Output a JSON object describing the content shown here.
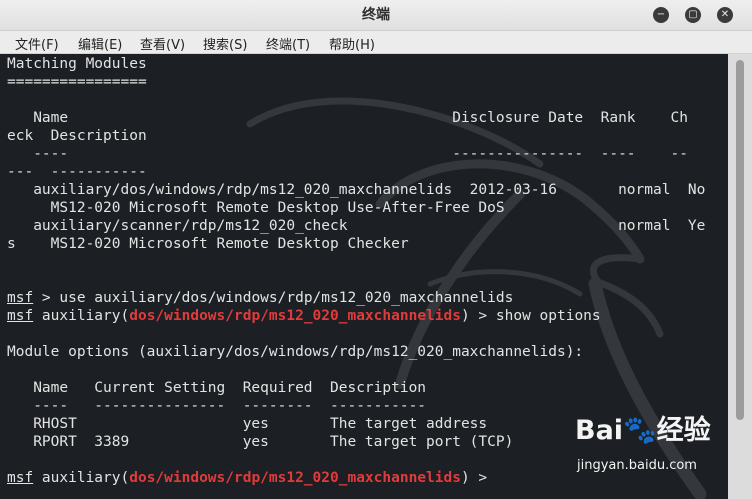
{
  "window": {
    "title": "终端",
    "minimize_glyph": "−",
    "maximize_glyph": "▢",
    "close_glyph": "✕"
  },
  "menu": [
    "文件(F)",
    "编辑(E)",
    "查看(V)",
    "搜索(S)",
    "终端(T)",
    "帮助(H)"
  ],
  "terminal": {
    "heading": "Matching Modules",
    "heading_rule": "================",
    "col_header_1": "   Name                                            Disclosure Date  Rank    Ch",
    "col_header_2": "eck  Description",
    "col_rule_1": "   ----                                            ---------------  ----    --",
    "col_rule_2": "---  -----------",
    "result1_line1": "   auxiliary/dos/windows/rdp/ms12_020_maxchannelids  2012-03-16       normal  No",
    "result1_line2": "     MS12-020 Microsoft Remote Desktop Use-After-Free DoS",
    "result2_line1": "   auxiliary/scanner/rdp/ms12_020_check                               normal  Ye",
    "result2_line2": "s    MS12-020 Microsoft Remote Desktop Checker",
    "prompt_word": "msf",
    "cmd_use": " > use auxiliary/dos/windows/rdp/ms12_020_maxchannelids",
    "module_prefix": " auxiliary(",
    "module_path": "dos/windows/rdp/ms12_020_maxchannelids",
    "cmd_show_suffix": ") > show options",
    "options_heading": "Module options (auxiliary/dos/windows/rdp/ms12_020_maxchannelids):",
    "opt_header": "   Name   Current Setting  Required  Description",
    "opt_rule": "   ----   ---------------  --------  -----------",
    "opt_row1": "   RHOST                   yes       The target address",
    "opt_row2": "   RPORT  3389             yes       The target port (TCP)",
    "final_suffix": ") > "
  },
  "watermark": {
    "logo": "Bai🐾经验",
    "url": "jingyan.baidu.com"
  }
}
